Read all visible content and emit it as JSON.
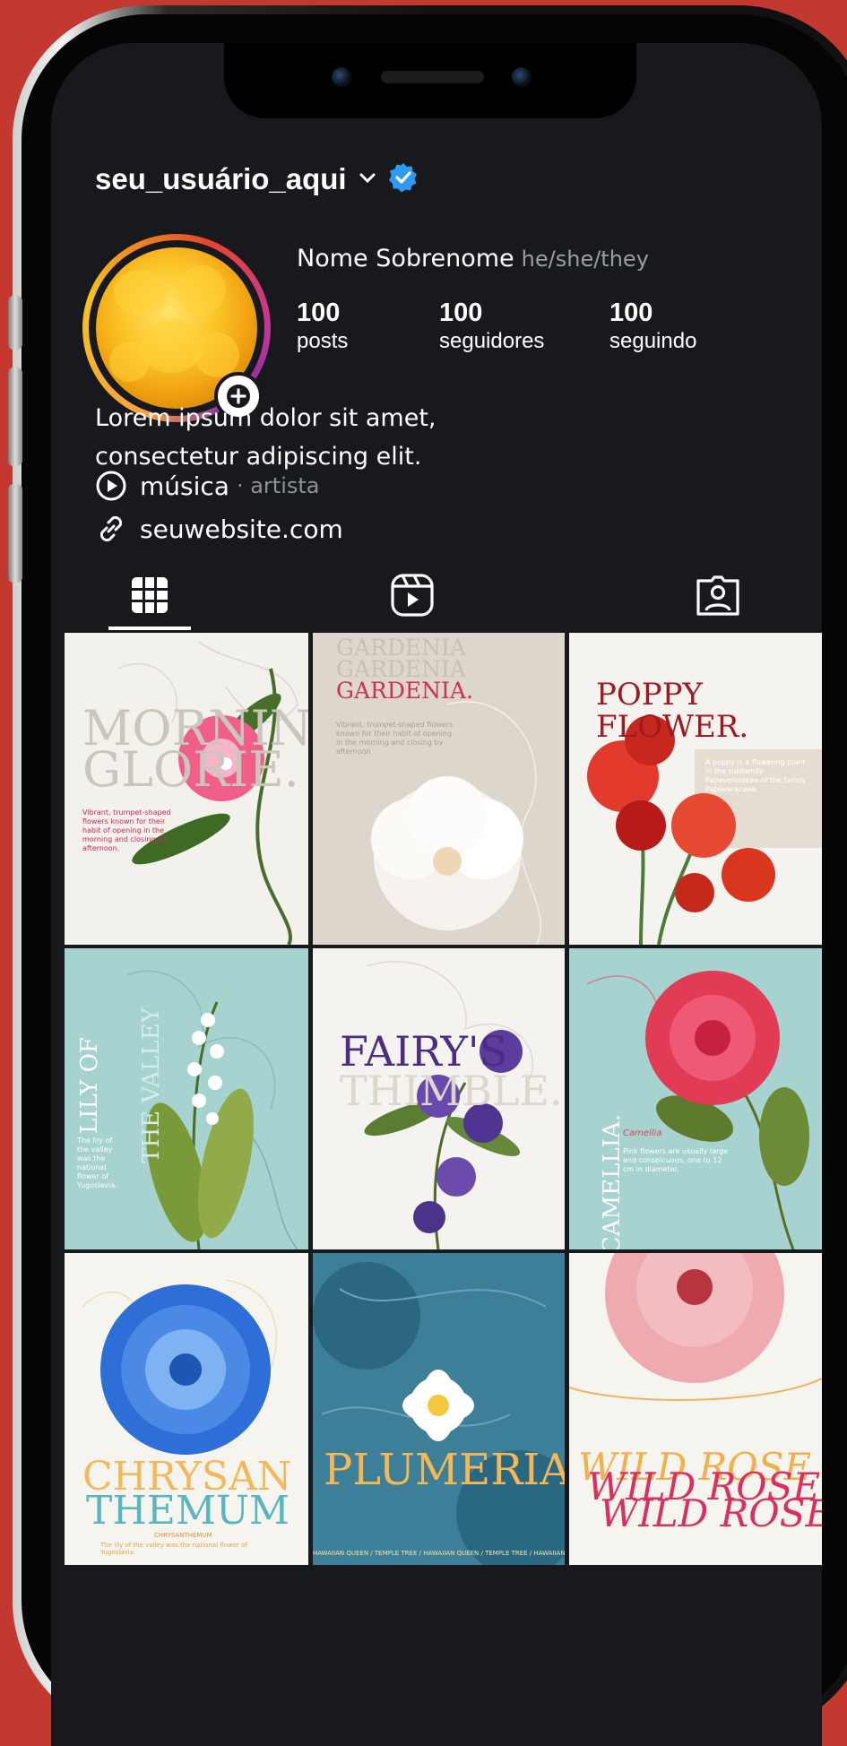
{
  "profile": {
    "username": "seu_usuário_aqui",
    "name": "Nome Sobrenome",
    "pronouns": "he/she/they",
    "stats": [
      {
        "value": "100",
        "label": "posts"
      },
      {
        "value": "100",
        "label": "seguidores"
      },
      {
        "value": "100",
        "label": "seguindo"
      }
    ],
    "bio_line1": "Lorem ipsum dolor sit amet,",
    "bio_line2": "consectetur adipiscing elit.",
    "music_title": "música",
    "music_artist": "· artista",
    "website": "seuwebsite.com"
  },
  "tabs": [
    {
      "icon": "grid-icon",
      "active": true
    },
    {
      "icon": "reels-icon",
      "active": false
    },
    {
      "icon": "tagged-icon",
      "active": false
    }
  ],
  "posts": [
    {
      "title_a": "MORNING",
      "title_b": "GLORIE.",
      "text": "Vibrant, trumpet-shaped flowers known for their habit of opening in the morning and closing by afternoon.",
      "bg": "#f3f1ec"
    },
    {
      "title_a": "GARDENIA",
      "title_b": "GARDENIA",
      "title_c": "GARDENIA.",
      "text": "Vibrant, trumpet-shaped flowers known for their habit of opening in the morning and closing by afternoon.",
      "bg": "#ddd6cc"
    },
    {
      "title_a": "POPPY",
      "title_b": "FLOWER.",
      "text": "A poppy is a flowering plant in the subfamily Papaveroideae of the family Papaveraceae.",
      "bg": "#f5f3ef"
    },
    {
      "title_a": "LILY OF",
      "title_b": "THE VALLEY",
      "text": "The lily of the valley was the national flower of Yugoslavia.",
      "bg": "#a6d2d0"
    },
    {
      "title_a": "FAIRY'S",
      "title_b": "THIMBLE.",
      "bg": "#f5f3ef"
    },
    {
      "title_a": "CAMELLIA.",
      "subtitle": "Camellia",
      "text": "Pink flowers are usually large and conspicuous, one to 12 cm in diameter.",
      "bg": "#a6d2d0"
    },
    {
      "title_a": "CHRYSAN",
      "title_b": "THEMUM",
      "subtitle": "CHRYSANTHEMUM",
      "text": "The lily of the valley was the national flower of Yugoslavia.",
      "bg": "#f6f4ef"
    },
    {
      "title_a": "PLUMERIA",
      "text": "HAWAIIAN QUEEN / TEMPLE TREE / HAWAIIAN QUEEN / TEMPLE TREE / HAWAIIAN QUEEN / TEMPLE TREE",
      "bg": "#3d7f98"
    },
    {
      "title_a": "WILD ROSE",
      "title_b": "WILD ROSE",
      "title_c": "WILD ROSE",
      "bg": "#f6f4ef"
    }
  ],
  "colors": {
    "screen_bg": "#17191c",
    "verified": "#2f9bf0",
    "background": "#c3392f"
  }
}
